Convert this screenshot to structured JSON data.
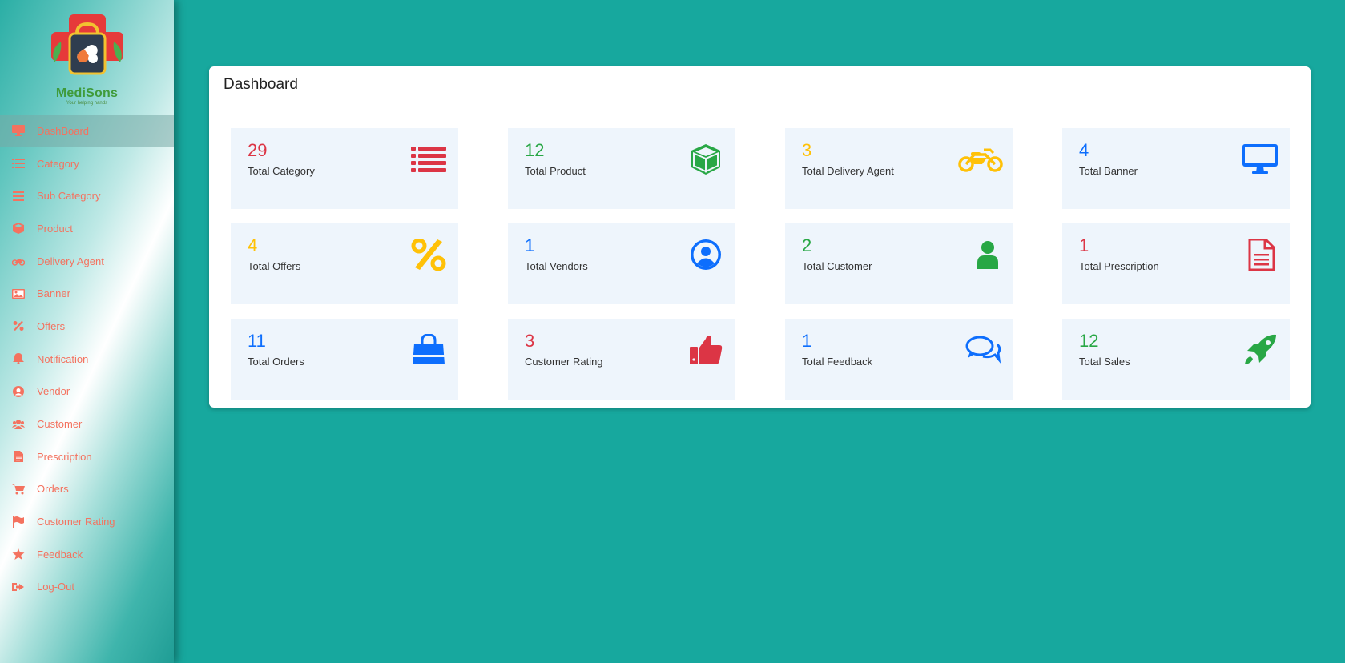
{
  "brand": {
    "name": "MediSons",
    "tagline": "Your helping hands"
  },
  "sidebar": {
    "items": [
      {
        "label": "DashBoard",
        "icon": "monitor-icon",
        "active": true
      },
      {
        "label": "Category",
        "icon": "list-icon"
      },
      {
        "label": "Sub Category",
        "icon": "bars-icon"
      },
      {
        "label": "Product",
        "icon": "box-icon"
      },
      {
        "label": "Delivery Agent",
        "icon": "motorcycle-icon"
      },
      {
        "label": "Banner",
        "icon": "image-icon"
      },
      {
        "label": "Offers",
        "icon": "percent-icon"
      },
      {
        "label": "Notification",
        "icon": "bell-icon"
      },
      {
        "label": "Vendor",
        "icon": "user-circle-icon"
      },
      {
        "label": "Customer",
        "icon": "users-icon"
      },
      {
        "label": "Prescription",
        "icon": "file-icon"
      },
      {
        "label": "Orders",
        "icon": "cart-icon"
      },
      {
        "label": "Customer Rating",
        "icon": "flag-icon"
      },
      {
        "label": "Feedback",
        "icon": "star-icon"
      },
      {
        "label": "Log-Out",
        "icon": "sign-out-icon"
      }
    ]
  },
  "main": {
    "title": "Dashboard",
    "tiles": [
      {
        "value": "29",
        "label": "Total Category",
        "icon": "list-icon",
        "color": "#dc3545"
      },
      {
        "value": "12",
        "label": "Total Product",
        "icon": "cube-icon",
        "color": "#28a745"
      },
      {
        "value": "3",
        "label": "Total Delivery Agent",
        "icon": "motorcycle-icon",
        "color": "#ffc107"
      },
      {
        "value": "4",
        "label": "Total Banner",
        "icon": "desktop-icon",
        "color": "#0d6efd"
      },
      {
        "value": "4",
        "label": "Total Offers",
        "icon": "percent-icon",
        "color": "#ffc107"
      },
      {
        "value": "1",
        "label": "Total Vendors",
        "icon": "user-circle-icon",
        "color": "#0d6efd"
      },
      {
        "value": "2",
        "label": "Total Customer",
        "icon": "user-icon",
        "color": "#28a745"
      },
      {
        "value": "1",
        "label": "Total Prescription",
        "icon": "file-text-icon",
        "color": "#dc3545"
      },
      {
        "value": "11",
        "label": "Total Orders",
        "icon": "shopping-bag-icon",
        "color": "#0d6efd"
      },
      {
        "value": "3",
        "label": "Customer Rating",
        "icon": "thumbs-up-icon",
        "color": "#dc3545"
      },
      {
        "value": "1",
        "label": "Total Feedback",
        "icon": "comments-icon",
        "color": "#0d6efd"
      },
      {
        "value": "12",
        "label": "Total Sales",
        "icon": "rocket-icon",
        "color": "#28a745"
      }
    ]
  }
}
